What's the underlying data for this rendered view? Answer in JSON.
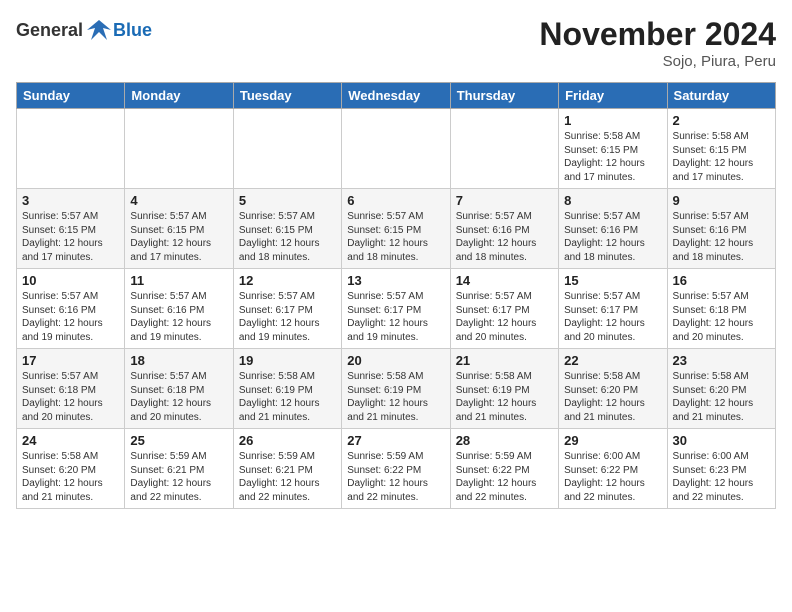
{
  "header": {
    "logo_general": "General",
    "logo_blue": "Blue",
    "month_title": "November 2024",
    "location": "Sojo, Piura, Peru"
  },
  "days_of_week": [
    "Sunday",
    "Monday",
    "Tuesday",
    "Wednesday",
    "Thursday",
    "Friday",
    "Saturday"
  ],
  "weeks": [
    [
      {
        "day": "",
        "detail": ""
      },
      {
        "day": "",
        "detail": ""
      },
      {
        "day": "",
        "detail": ""
      },
      {
        "day": "",
        "detail": ""
      },
      {
        "day": "",
        "detail": ""
      },
      {
        "day": "1",
        "detail": "Sunrise: 5:58 AM\nSunset: 6:15 PM\nDaylight: 12 hours and 17 minutes."
      },
      {
        "day": "2",
        "detail": "Sunrise: 5:58 AM\nSunset: 6:15 PM\nDaylight: 12 hours and 17 minutes."
      }
    ],
    [
      {
        "day": "3",
        "detail": "Sunrise: 5:57 AM\nSunset: 6:15 PM\nDaylight: 12 hours and 17 minutes."
      },
      {
        "day": "4",
        "detail": "Sunrise: 5:57 AM\nSunset: 6:15 PM\nDaylight: 12 hours and 17 minutes."
      },
      {
        "day": "5",
        "detail": "Sunrise: 5:57 AM\nSunset: 6:15 PM\nDaylight: 12 hours and 18 minutes."
      },
      {
        "day": "6",
        "detail": "Sunrise: 5:57 AM\nSunset: 6:15 PM\nDaylight: 12 hours and 18 minutes."
      },
      {
        "day": "7",
        "detail": "Sunrise: 5:57 AM\nSunset: 6:16 PM\nDaylight: 12 hours and 18 minutes."
      },
      {
        "day": "8",
        "detail": "Sunrise: 5:57 AM\nSunset: 6:16 PM\nDaylight: 12 hours and 18 minutes."
      },
      {
        "day": "9",
        "detail": "Sunrise: 5:57 AM\nSunset: 6:16 PM\nDaylight: 12 hours and 18 minutes."
      }
    ],
    [
      {
        "day": "10",
        "detail": "Sunrise: 5:57 AM\nSunset: 6:16 PM\nDaylight: 12 hours and 19 minutes."
      },
      {
        "day": "11",
        "detail": "Sunrise: 5:57 AM\nSunset: 6:16 PM\nDaylight: 12 hours and 19 minutes."
      },
      {
        "day": "12",
        "detail": "Sunrise: 5:57 AM\nSunset: 6:17 PM\nDaylight: 12 hours and 19 minutes."
      },
      {
        "day": "13",
        "detail": "Sunrise: 5:57 AM\nSunset: 6:17 PM\nDaylight: 12 hours and 19 minutes."
      },
      {
        "day": "14",
        "detail": "Sunrise: 5:57 AM\nSunset: 6:17 PM\nDaylight: 12 hours and 20 minutes."
      },
      {
        "day": "15",
        "detail": "Sunrise: 5:57 AM\nSunset: 6:17 PM\nDaylight: 12 hours and 20 minutes."
      },
      {
        "day": "16",
        "detail": "Sunrise: 5:57 AM\nSunset: 6:18 PM\nDaylight: 12 hours and 20 minutes."
      }
    ],
    [
      {
        "day": "17",
        "detail": "Sunrise: 5:57 AM\nSunset: 6:18 PM\nDaylight: 12 hours and 20 minutes."
      },
      {
        "day": "18",
        "detail": "Sunrise: 5:57 AM\nSunset: 6:18 PM\nDaylight: 12 hours and 20 minutes."
      },
      {
        "day": "19",
        "detail": "Sunrise: 5:58 AM\nSunset: 6:19 PM\nDaylight: 12 hours and 21 minutes."
      },
      {
        "day": "20",
        "detail": "Sunrise: 5:58 AM\nSunset: 6:19 PM\nDaylight: 12 hours and 21 minutes."
      },
      {
        "day": "21",
        "detail": "Sunrise: 5:58 AM\nSunset: 6:19 PM\nDaylight: 12 hours and 21 minutes."
      },
      {
        "day": "22",
        "detail": "Sunrise: 5:58 AM\nSunset: 6:20 PM\nDaylight: 12 hours and 21 minutes."
      },
      {
        "day": "23",
        "detail": "Sunrise: 5:58 AM\nSunset: 6:20 PM\nDaylight: 12 hours and 21 minutes."
      }
    ],
    [
      {
        "day": "24",
        "detail": "Sunrise: 5:58 AM\nSunset: 6:20 PM\nDaylight: 12 hours and 21 minutes."
      },
      {
        "day": "25",
        "detail": "Sunrise: 5:59 AM\nSunset: 6:21 PM\nDaylight: 12 hours and 22 minutes."
      },
      {
        "day": "26",
        "detail": "Sunrise: 5:59 AM\nSunset: 6:21 PM\nDaylight: 12 hours and 22 minutes."
      },
      {
        "day": "27",
        "detail": "Sunrise: 5:59 AM\nSunset: 6:22 PM\nDaylight: 12 hours and 22 minutes."
      },
      {
        "day": "28",
        "detail": "Sunrise: 5:59 AM\nSunset: 6:22 PM\nDaylight: 12 hours and 22 minutes."
      },
      {
        "day": "29",
        "detail": "Sunrise: 6:00 AM\nSunset: 6:22 PM\nDaylight: 12 hours and 22 minutes."
      },
      {
        "day": "30",
        "detail": "Sunrise: 6:00 AM\nSunset: 6:23 PM\nDaylight: 12 hours and 22 minutes."
      }
    ]
  ]
}
